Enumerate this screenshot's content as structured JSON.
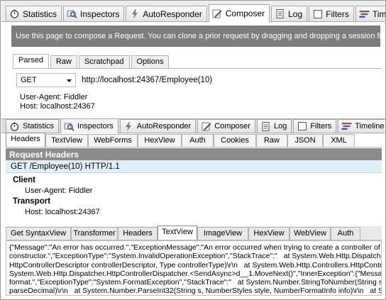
{
  "top_tabs": [
    {
      "label": "Statistics",
      "icon": "stopwatch-icon",
      "active": false
    },
    {
      "label": "Inspectors",
      "icon": "inspector-icon",
      "active": false
    },
    {
      "label": "AutoResponder",
      "icon": "lightning-icon",
      "active": false
    },
    {
      "label": "Composer",
      "icon": "pencil-icon",
      "active": true
    },
    {
      "label": "Log",
      "icon": "log-icon",
      "active": false
    },
    {
      "label": "Filters",
      "icon": "checkbox-icon",
      "active": false
    },
    {
      "label": "Timeline",
      "icon": "timeline-icon",
      "active": false
    }
  ],
  "composer": {
    "banner": "Use this page to compose a Request. You can clone a prior request by dragging and dropping a session fr",
    "tabs": [
      "Parsed",
      "Raw",
      "Scratchpad",
      "Options"
    ],
    "active_tab": "Parsed",
    "method": "GET",
    "url": "http://localhost:24367/Employee(10)",
    "headers": [
      "User-Agent: Fiddler",
      "Host: localhost:24367"
    ]
  },
  "inspector_tabs": [
    {
      "label": "Statistics",
      "icon": "stopwatch-icon",
      "active": false
    },
    {
      "label": "Inspectors",
      "icon": "inspector-icon",
      "active": true
    },
    {
      "label": "AutoResponder",
      "icon": "lightning-icon",
      "active": false
    },
    {
      "label": "Composer",
      "icon": "pencil-icon",
      "active": false
    },
    {
      "label": "Log",
      "icon": "log-icon",
      "active": false
    },
    {
      "label": "Filters",
      "icon": "checkbox-icon",
      "active": false
    },
    {
      "label": "Timeline",
      "icon": "timeline-icon",
      "active": false
    }
  ],
  "request_view_tabs": [
    "Headers",
    "TextView",
    "WebForms",
    "HexView",
    "Auth",
    "Cookies",
    "Raw",
    "JSON",
    "XML"
  ],
  "request_view_active": "Headers",
  "request_headers": {
    "title": "Request Headers",
    "first_line": "GET /Employee(10) HTTP/1.1",
    "groups": [
      {
        "name": "Client",
        "items": [
          "User-Agent: Fiddler"
        ]
      },
      {
        "name": "Transport",
        "items": [
          "Host: localhost:24367"
        ]
      }
    ]
  },
  "response_view_tabs": [
    "Get SyntaxView",
    "Transformer",
    "Headers",
    "TextView",
    "ImageView",
    "HexView",
    "WebView",
    "Auth"
  ],
  "response_view_active": "TextView",
  "response_text": [
    "{\"Message\":\"An error has occurred.\",\"ExceptionMessage\":\"An error occurred when trying to create a controller of t",
    "constructor.\",\"ExceptionType\":\"System.InvalidOperationException\",\"StackTrace\":\"   at System.Web.Http.Dispatch",
    "HttpControllerDescriptor controllerDescriptor, Type controllerType)\\r\\n   at System.Web.Http.Controllers.HttpControll",
    "System.Web.Http.Dispatcher.HttpControllerDispatcher.<SendAsync>d__1.MoveNext()\",\"InnerException\":{\"Messag",
    "format.\",\"ExceptionType\":\"System.FormatException\",\"StackTrace\":\"   at System.Number.StringToNumber(String st",
    "parseDecimal)\\r\\n   at System.Number.ParseInt32(String s, NumberStyles style, NumberFormatInfo info)\\r\\n   at Sy"
  ]
}
